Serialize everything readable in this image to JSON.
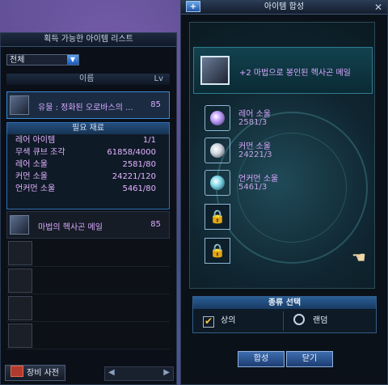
{
  "left_panel": {
    "title": "획득 가능한 아이템 리스트",
    "filter_value": "전체",
    "col_name": "이름",
    "col_lv": "Lv",
    "items": [
      {
        "name": "유물 : 정화된 오로바스의 ...",
        "lv": "85"
      },
      {
        "name": "마법의 헥사곤 메일",
        "lv": "85"
      }
    ],
    "materials": {
      "header": "필요 재료",
      "rows": [
        {
          "name": "레어 아이템",
          "value": "1/1"
        },
        {
          "name": "무색 큐브 조각",
          "value": "61858/4000"
        },
        {
          "name": "레어 소울",
          "value": "2581/80"
        },
        {
          "name": "커먼 소울",
          "value": "24221/120"
        },
        {
          "name": "언커먼 소울",
          "value": "5461/80"
        }
      ]
    },
    "dict_button": "장비 사전"
  },
  "right_panel": {
    "title": "아이템 합성",
    "result_name": "+2 마법으로 봉인된 헥사곤 메일",
    "materials": [
      {
        "name": "레어 소울",
        "count": "2581/3"
      },
      {
        "name": "커먼 소울",
        "count": "24221/3"
      },
      {
        "name": "언커먼 소울",
        "count": "5461/3"
      }
    ],
    "kind": {
      "header": "종류 선택",
      "opt1": "상의",
      "opt2": "랜덤"
    },
    "buttons": {
      "combine": "합성",
      "close": "닫기"
    }
  },
  "colors": {
    "item_text": "#d9a9ff",
    "accent": "#2f6fb0"
  }
}
